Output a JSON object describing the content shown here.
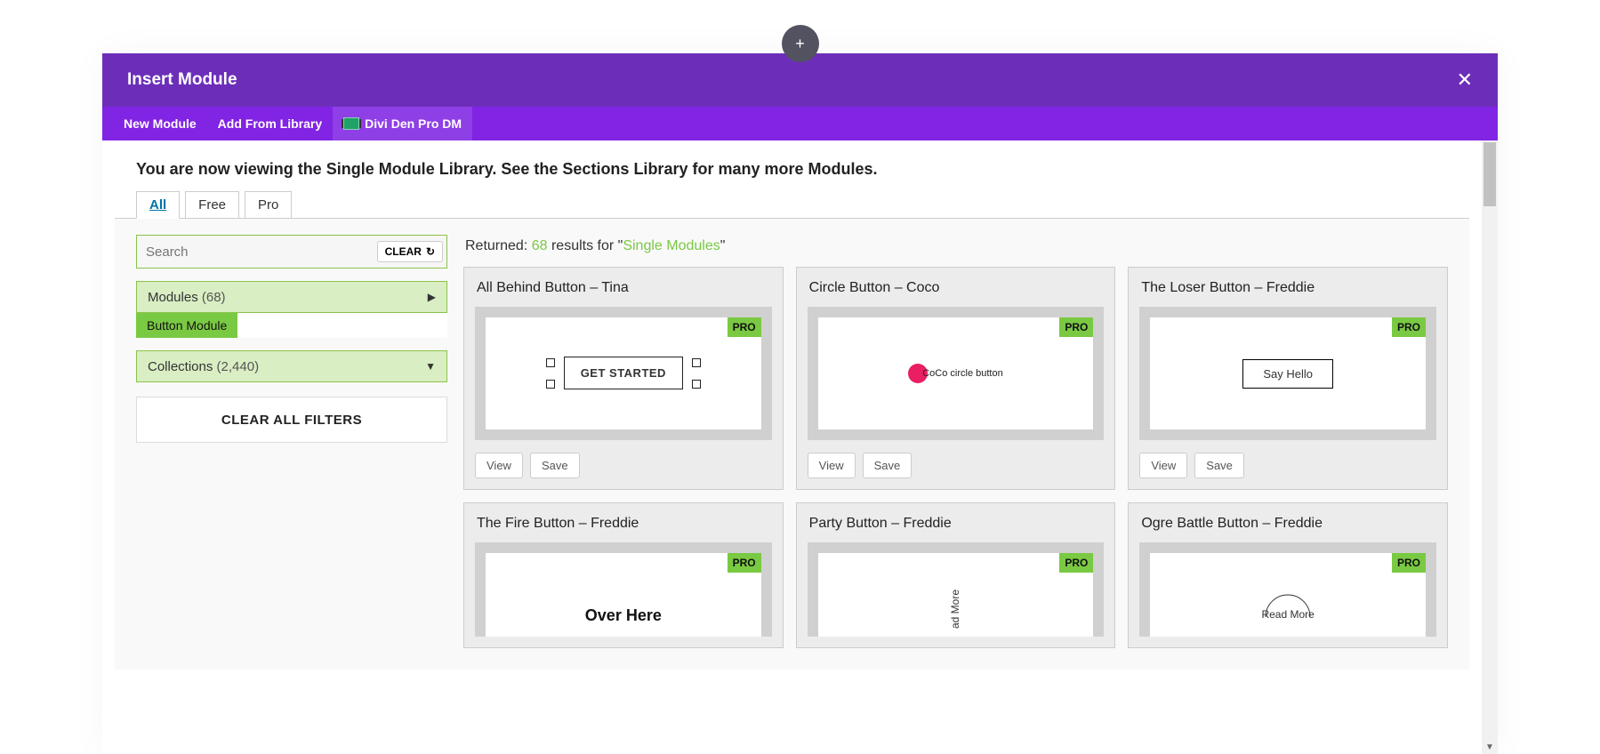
{
  "header": {
    "title": "Insert Module",
    "close": "✕",
    "add": "+"
  },
  "tabs": {
    "new": "New Module",
    "library": "Add From Library",
    "ddp": "Divi Den Pro DM"
  },
  "intro": "You are now viewing the Single Module Library. See the Sections Library for many more Modules.",
  "filterTabs": {
    "all": "All",
    "free": "Free",
    "pro": "Pro"
  },
  "search": {
    "placeholder": "Search",
    "clear": "CLEAR"
  },
  "accordions": {
    "modules_label": "Modules",
    "modules_count": "(68)",
    "collections_label": "Collections",
    "collections_count": "(2,440)"
  },
  "chip": "Button Module",
  "clearFilters": "CLEAR ALL FILTERS",
  "results": {
    "prefix": "Returned: ",
    "count": "68",
    "mid": " results for \"",
    "term": "Single Modules",
    "suffix": "\""
  },
  "badge": "PRO",
  "buttons": {
    "view": "View",
    "save": "Save"
  },
  "cards": [
    {
      "title": "All Behind Button – Tina",
      "demo": "GET STARTED"
    },
    {
      "title": "Circle Button – Coco",
      "demo": "CoCo circle button"
    },
    {
      "title": "The Loser Button – Freddie",
      "demo": "Say Hello"
    },
    {
      "title": "The Fire Button – Freddie",
      "demo": "Over Here"
    },
    {
      "title": "Party Button – Freddie",
      "demo": "ad More"
    },
    {
      "title": "Ogre Battle Button – Freddie",
      "demo": "Read More"
    }
  ]
}
